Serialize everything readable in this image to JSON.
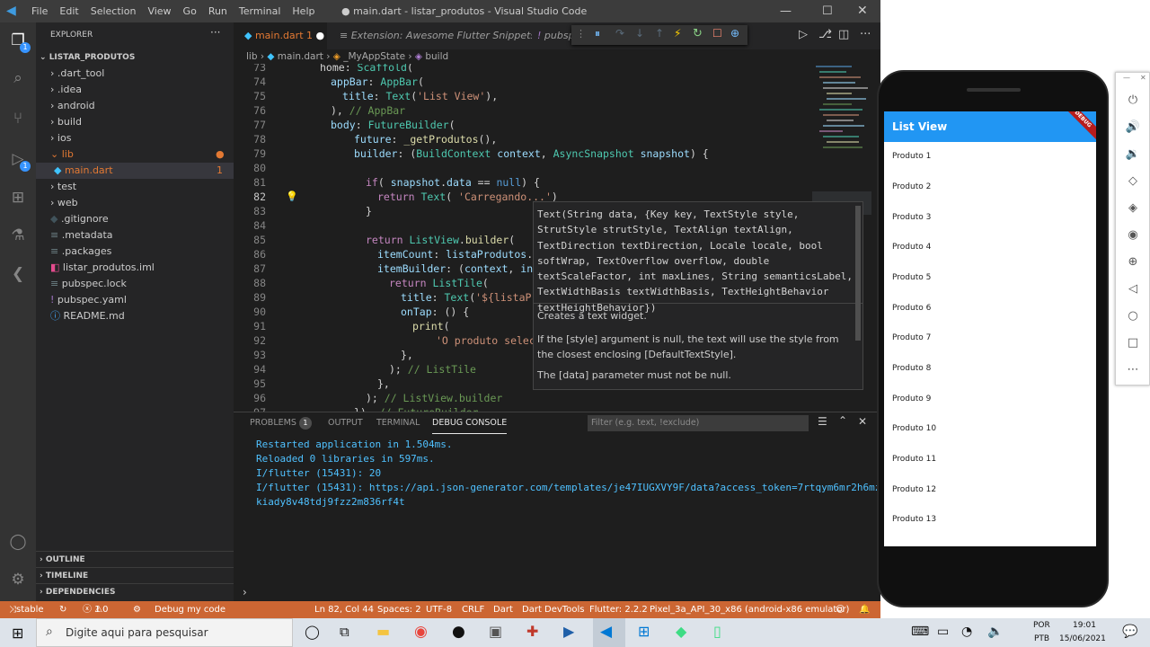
{
  "window": {
    "title": "● main.dart - listar_produtos - Visual Studio Code"
  },
  "menu": [
    "File",
    "Edit",
    "Selection",
    "View",
    "Go",
    "Run",
    "Terminal",
    "Help"
  ],
  "explorer": {
    "header": "EXPLORER",
    "project": "LISTAR_PRODUTOS",
    "items": [
      ".dart_tool",
      ".idea",
      "android",
      "build",
      "ios",
      "lib",
      "main.dart",
      "test",
      "web",
      ".gitignore",
      ".metadata",
      ".packages",
      "listar_produtos.iml",
      "pubspec.lock",
      "pubspec.yaml",
      "README.md"
    ],
    "main_badge": "1",
    "sections": [
      "OUTLINE",
      "TIMELINE",
      "DEPENDENCIES"
    ]
  },
  "tabs": {
    "main": "main.dart",
    "main_count": "1",
    "ext": "Extension: Awesome Flutter Snippets",
    "pub": "pubsp"
  },
  "breadcrumb": [
    "lib",
    "main.dart",
    "_MyAppState",
    "build"
  ],
  "hover": {
    "signature": "Text(String data, {Key key, TextStyle style, StrutStyle strutStyle, TextAlign textAlign, TextDirection textDirection, Locale locale, bool softWrap, TextOverflow overflow, double textScaleFactor, int maxLines, String semanticsLabel, TextWidthBasis textWidthBasis, TextHeightBehavior textHeightBehavior})",
    "doc1": "Creates a text widget.",
    "doc2": "If the [style] argument is null, the text will use the style from the closest enclosing [DefaultTextStyle].",
    "doc3": "The [data] parameter must not be null."
  },
  "panel": {
    "tabs": [
      "PROBLEMS",
      "OUTPUT",
      "TERMINAL",
      "DEBUG CONSOLE"
    ],
    "problems_count": "1",
    "filter_placeholder": "Filter (e.g. text, !exclude)",
    "lines": [
      "Restarted application in 1.504ms.",
      "Reloaded 0 libraries in 597ms.",
      "I/flutter (15431): 20",
      "I/flutter (15431): https://api.json-generator.com/templates/je47IUGXVY9F/data?access_token=7rtqym6mr2h6mzs",
      "kiady8v48tdj9fzz2m836rf4t"
    ]
  },
  "status": {
    "branch": "stable",
    "errors": "1",
    "warnings": "0",
    "debug": "Debug my code",
    "position": "Ln 82, Col 44",
    "spaces": "Spaces: 2",
    "encoding": "UTF-8",
    "eol": "CRLF",
    "lang": "Dart",
    "devtools": "Dart DevTools",
    "flutter": "Flutter: 2.2.2",
    "device": "Pixel_3a_API_30_x86 (android-x86 emulator)"
  },
  "app": {
    "title": "List View",
    "banner": "DEBUG",
    "items": [
      "Produto 1",
      "Produto 2",
      "Produto 3",
      "Produto 4",
      "Produto 5",
      "Produto 6",
      "Produto 7",
      "Produto 8",
      "Produto 9",
      "Produto 10",
      "Produto 11",
      "Produto 12",
      "Produto 13"
    ]
  },
  "taskbar": {
    "search": "Digite aqui para pesquisar",
    "lang1": "POR",
    "lang2": "PTB",
    "time": "19:01",
    "date": "15/06/2021"
  }
}
